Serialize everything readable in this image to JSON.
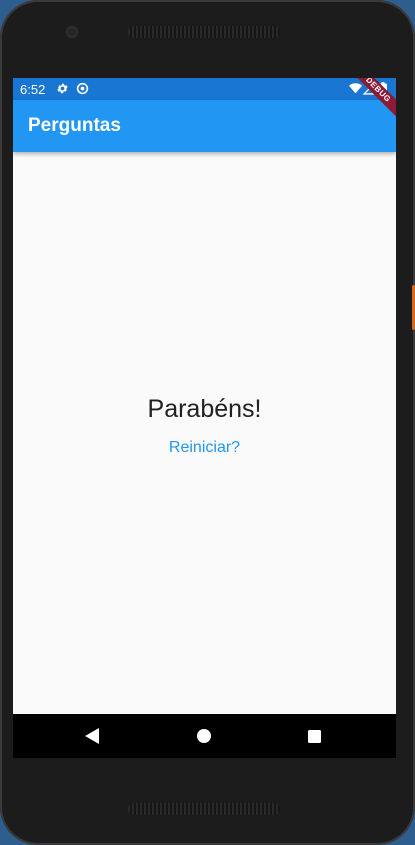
{
  "status_bar": {
    "time": "6:52",
    "icons": [
      "gear-icon",
      "sync-icon",
      "wifi-icon",
      "signal-icon",
      "battery-icon"
    ],
    "color": "#1976d2"
  },
  "debug_banner": "DEBUG",
  "app_bar": {
    "title": "Perguntas",
    "color": "#2196f3"
  },
  "result": {
    "message": "Parabéns!",
    "restart_label": "Reiniciar?"
  },
  "nav_bar": {
    "buttons": [
      "back-icon",
      "home-icon",
      "recents-icon"
    ]
  }
}
